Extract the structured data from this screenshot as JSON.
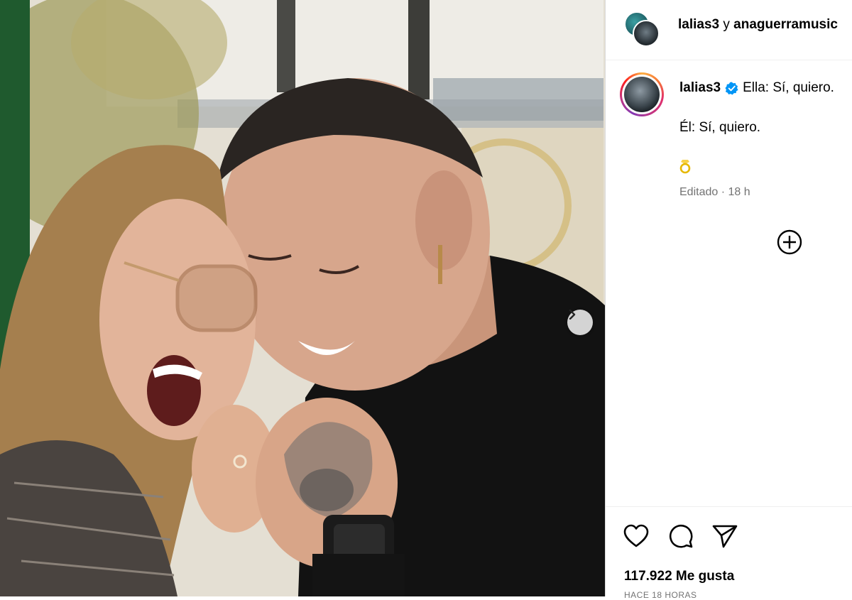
{
  "header": {
    "user1": "lalias3",
    "separator": "y",
    "user2": "anaguerramusic"
  },
  "caption": {
    "username": "lalias3",
    "verified": true,
    "line1": "Ella: Sí, quiero.",
    "line2": "Él: Sí, quiero.",
    "emoji": "💍",
    "meta": "Editado · 18 h"
  },
  "icons": {
    "next": "chevron-right-icon",
    "add": "plus-circle-icon",
    "like": "heart-icon",
    "comment": "comment-icon",
    "share": "send-icon",
    "verified": "verified-badge-icon"
  },
  "footer": {
    "likes": "117.922 Me gusta",
    "time": "HACE 18 HORAS"
  },
  "colors": {
    "verified": "#0095f6",
    "ring_gradient": [
      "#fcaf45",
      "#f77737",
      "#e1306c",
      "#c13584",
      "#833ab4"
    ],
    "meta_gray": "#737373"
  }
}
